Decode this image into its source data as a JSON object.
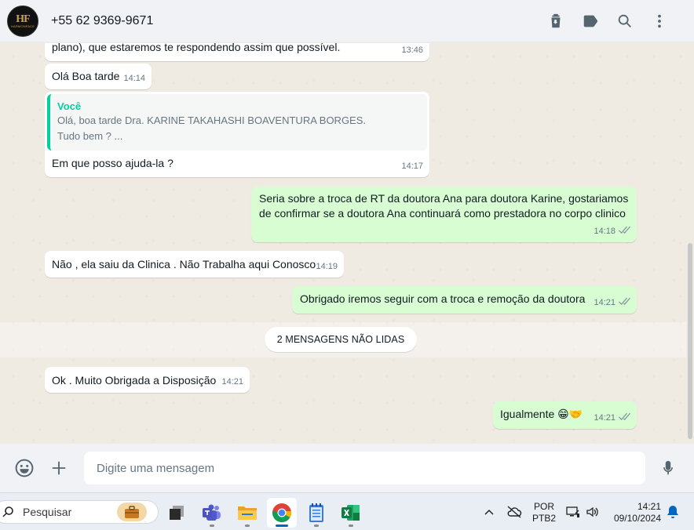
{
  "header": {
    "avatar_logo": "HF",
    "avatar_brand": "HARMONFACE",
    "contact_name": "+55 62 9369-9671",
    "icons": [
      "delete-icon",
      "label-icon",
      "search-icon",
      "menu-icon"
    ]
  },
  "messages": [
    {
      "dir": "in",
      "text": "plano), que estaremos te respondendo assim que possível.",
      "time": "13:46"
    },
    {
      "dir": "in",
      "text": "Olá Boa tarde",
      "time": "14:14"
    },
    {
      "dir": "in",
      "quote_author": "Você",
      "quote_line1": "Olá, boa tarde Dra. KARINE TAKAHASHI BOAVENTURA BORGES.",
      "quote_line2": "Tudo bem ? ...",
      "text": "Em que posso ajuda-la ?",
      "time": "14:17"
    },
    {
      "dir": "out",
      "text": "Seria sobre a troca de RT da doutora Ana para doutora Karine, gostariamos de confirmar se a doutora Ana continuará como prestadora no corpo clinico",
      "time": "14:18"
    },
    {
      "dir": "in",
      "text": "Não , ela saiu da Clinica . Não Trabalha aqui Conosco",
      "time": "14:19"
    },
    {
      "dir": "out",
      "text": "Obrigado iremos seguir com a troca e remoção da doutora",
      "time": "14:21"
    },
    {
      "dir": "in",
      "text": "Ok . Muito Obrigada a Disposição",
      "time": "14:21"
    },
    {
      "dir": "out",
      "text": "Igualmente 😁🤝",
      "time": "14:21"
    }
  ],
  "unread_label": "2 MENSAGENS NÃO LIDAS",
  "composer": {
    "placeholder": "Digite uma mensagem"
  },
  "taskbar": {
    "search_label": "Pesquisar",
    "apps": [
      "task-view-icon",
      "teams-icon",
      "file-explorer-icon",
      "chrome-icon",
      "notepad-icon",
      "excel-icon"
    ],
    "lang_line1": "POR",
    "lang_line2": "PTB2",
    "time": "14:21",
    "date": "09/10/2024"
  },
  "colors": {
    "incoming": "#ffffff",
    "outgoing": "#d9fdd3",
    "quote_accent": "#06cf9c",
    "chat_bg": "#efeae2"
  }
}
